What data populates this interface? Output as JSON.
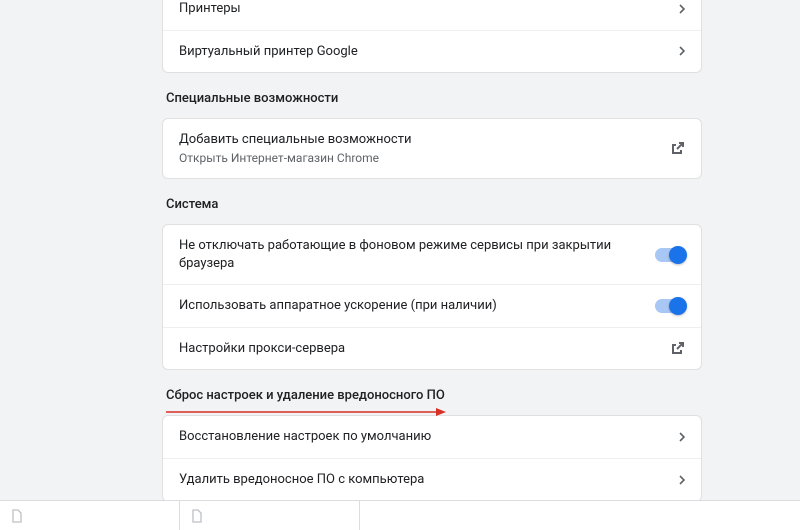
{
  "printing": {
    "printers": "Принтеры",
    "cloudPrint": "Виртуальный принтер Google"
  },
  "accessibility": {
    "title": "Специальные возможности",
    "addLabel": "Добавить специальные возможности",
    "addSub": "Открыть Интернет-магазин Chrome"
  },
  "system": {
    "title": "Система",
    "bgApps": "Не отключать работающие в фоновом режиме сервисы при закрытии браузера",
    "hwAccel": "Использовать аппаратное ускорение (при наличии)",
    "proxy": "Настройки прокси-сервера"
  },
  "reset": {
    "title": "Сброс настроек и удаление вредоносного ПО",
    "restore": "Восстановление настроек по умолчанию",
    "cleanup": "Удалить вредоносное ПО с компьютера"
  }
}
